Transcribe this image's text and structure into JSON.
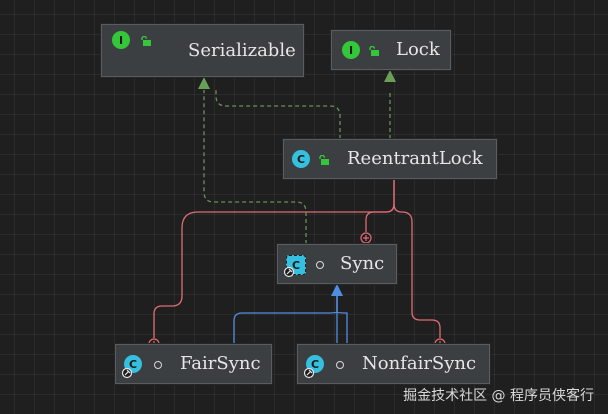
{
  "diagram": {
    "nodes": [
      {
        "id": "serializable",
        "name": "Serializable",
        "kind": "interface",
        "badge": "I",
        "modifier": "public"
      },
      {
        "id": "lock",
        "name": "Lock",
        "kind": "interface",
        "badge": "I",
        "modifier": "public"
      },
      {
        "id": "reentrantlock",
        "name": "ReentrantLock",
        "kind": "class",
        "badge": "C",
        "modifier": "public"
      },
      {
        "id": "sync",
        "name": "Sync",
        "kind": "abstract-static-class",
        "badge": "C",
        "modifier": "package-private"
      },
      {
        "id": "fairsync",
        "name": "FairSync",
        "kind": "static-class",
        "badge": "C",
        "modifier": "package-private"
      },
      {
        "id": "nonfairsync",
        "name": "NonfairSync",
        "kind": "static-class",
        "badge": "C",
        "modifier": "package-private"
      }
    ],
    "edges": [
      {
        "from": "reentrantlock",
        "to": "lock",
        "type": "implements"
      },
      {
        "from": "reentrantlock",
        "to": "serializable",
        "type": "implements"
      },
      {
        "from": "sync",
        "to": "serializable",
        "type": "implements"
      },
      {
        "from": "fairsync",
        "to": "sync",
        "type": "extends"
      },
      {
        "from": "nonfairsync",
        "to": "sync",
        "type": "extends"
      },
      {
        "from": "sync",
        "to": "reentrantlock",
        "type": "inner-class"
      },
      {
        "from": "fairsync",
        "to": "reentrantlock",
        "type": "inner-class"
      },
      {
        "from": "nonfairsync",
        "to": "reentrantlock",
        "type": "inner-class"
      }
    ],
    "colors": {
      "implements": "#6a9f58",
      "implements_dashed": "#6a8f5a",
      "extends": "#4f8fe0",
      "inner": "#e06c75",
      "interface_badge": "#34c73a",
      "class_badge": "#36c0e0"
    }
  },
  "watermark": "掘金技术社区 @ 程序员侠客行"
}
